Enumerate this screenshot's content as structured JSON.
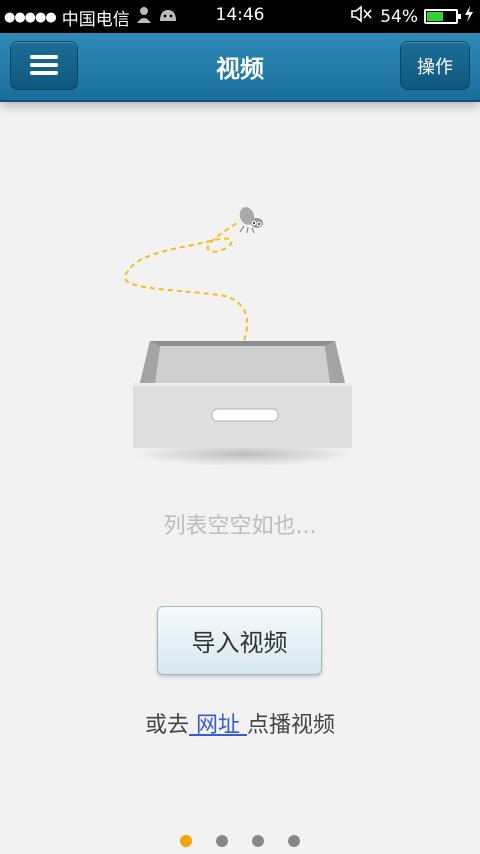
{
  "status_bar": {
    "signal_dots": "●●●●●",
    "carrier": "中国电信",
    "time": "14:46",
    "battery_percent": "54%",
    "battery_level": 0.54
  },
  "header": {
    "title": "视频",
    "action_label": "操作"
  },
  "empty_state": {
    "message": "列表空空如也..."
  },
  "import_button_label": "导入视频",
  "link_row": {
    "prefix": "或去",
    "link": " 网址 ",
    "suffix": "点播视频"
  },
  "pager": {
    "count": 4,
    "active_index": 0
  },
  "colors": {
    "header": "#1a6e9c",
    "link": "#3b5bd6",
    "active_dot": "#f5a300"
  }
}
